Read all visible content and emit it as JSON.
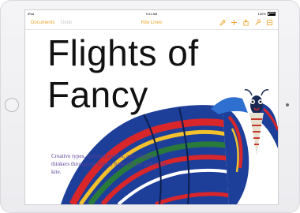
{
  "statusbar": {
    "carrier": "iPad",
    "time": "9:41 AM",
    "battery": "100%"
  },
  "toolbar": {
    "back_label": "Documents",
    "undo_label": "Undo",
    "title": "Kite Lines"
  },
  "icons": [
    "brush-icon",
    "plus-icon",
    "share-icon",
    "wrench-icon",
    "more-icon"
  ],
  "document": {
    "title_line1": "Flights of",
    "title_line2": "Fancy",
    "caption": "Creative types, spiritual seekers, and original thinkers throughout history have felt the pull of the kite."
  },
  "colors": {
    "accent": "#f0a32a",
    "caption": "#5a3f9a"
  }
}
